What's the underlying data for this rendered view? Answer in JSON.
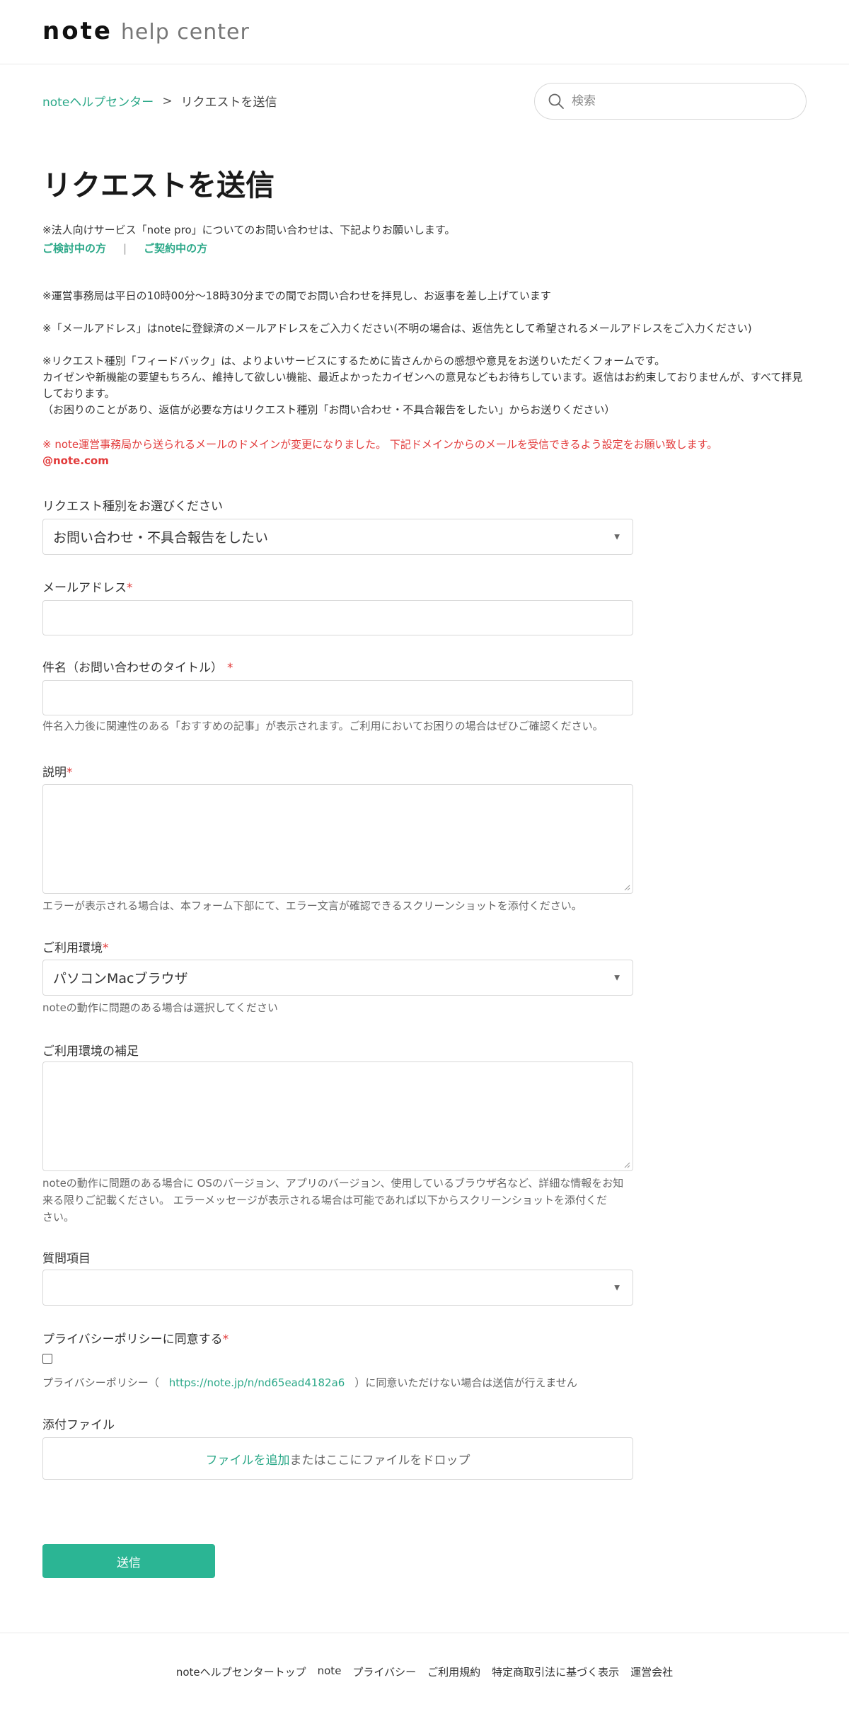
{
  "header": {
    "brand": "note",
    "sub": "help center"
  },
  "breadcrumb": {
    "home": "noteヘルプセンター",
    "separator": ">",
    "current": "リクエストを送信"
  },
  "search": {
    "placeholder": "検索",
    "icon": "search-icon"
  },
  "page_title": "リクエストを送信",
  "intro": {
    "pro_note": "※法人向けサービス「note pro」についてのお問い合わせは、下記よりお願いします。",
    "link_considering": "ご検討中の方",
    "link_separator": "|",
    "link_contracted": "ご契約中の方",
    "hours_note": "※運営事務局は平日の10時00分〜18時30分までの間でお問い合わせを拝見し、お返事を差し上げています",
    "email_note": "※「メールアドレス」はnoteに登録済のメールアドレスをご入力ください(不明の場合は、返信先として希望されるメールアドレスをご入力ください)",
    "feedback_note_1": "※リクエスト種別「フィードバック」は、よりよいサービスにするために皆さんからの感想や意見をお送りいただくフォームです。",
    "feedback_note_2": "カイゼンや新機能の要望もちろん、維持して欲しい機能、最近よかったカイゼンへの意見などもお待ちしています。返信はお約束しておりませんが、すべて拝見しております。",
    "feedback_note_3": "（お困りのことがあり、返信が必要な方はリクエスト種別「お問い合わせ・不具合報告をしたい」からお送りください）",
    "domain_notice": "※ note運営事務局から送られるメールのドメインが変更になりました。 下記ドメインからのメールを受信できるよう設定をお願い致します。",
    "domain": "@note.com"
  },
  "form": {
    "request_type": {
      "label": "リクエスト種別をお選びください",
      "value": "お問い合わせ・不具合報告をしたい"
    },
    "email": {
      "label": "メールアドレス",
      "required_mark": "*",
      "value": ""
    },
    "subject": {
      "label": "件名（お問い合わせのタイトル）",
      "required_mark": "*",
      "value": "",
      "hint": "件名入力後に関連性のある「おすすめの記事」が表示されます。ご利用においてお困りの場合はぜひご確認ください。"
    },
    "description": {
      "label": "説明",
      "required_mark": "*",
      "value": "",
      "hint": "エラーが表示される場合は、本フォーム下部にて、エラー文言が確認できるスクリーンショットを添付ください。"
    },
    "environment": {
      "label": "ご利用環境",
      "required_mark": "*",
      "value": "パソコンMacブラウザ",
      "hint": "noteの動作に問題のある場合は選択してください"
    },
    "environment_detail": {
      "label": "ご利用環境の補足",
      "value": "",
      "hint_1": "noteの動作に問題のある場合に OSのバージョン、アプリのバージョン、使用しているブラウザ名など、詳細な情報をお知",
      "hint_2": "来る限りご記載ください。 エラーメッセージが表示される場合は可能であれば以下からスクリーンショットを添付くだ",
      "hint_3": "さい。"
    },
    "question_item": {
      "label": "質問項目",
      "value": ""
    },
    "privacy": {
      "label": "プライバシーポリシーに同意する",
      "required_mark": "*",
      "checked": false,
      "text_before": "プライバシーポリシー（",
      "link": "https://note.jp/n/nd65ead4182a6",
      "text_after": "）に同意いただけない場合は送信が行えません"
    },
    "attachment": {
      "label": "添付ファイル",
      "add_link": "ファイルを追加",
      "drop_text": "またはここにファイルをドロップ"
    },
    "submit_label": "送信"
  },
  "footer": {
    "links": [
      "noteヘルプセンタートップ",
      "note",
      "プライバシー",
      "ご利用規約",
      "特定商取引法に基づく表示",
      "運営会社"
    ]
  },
  "colors": {
    "accent": "#2ba888",
    "button": "#2bb594",
    "required": "#e23a3a"
  }
}
